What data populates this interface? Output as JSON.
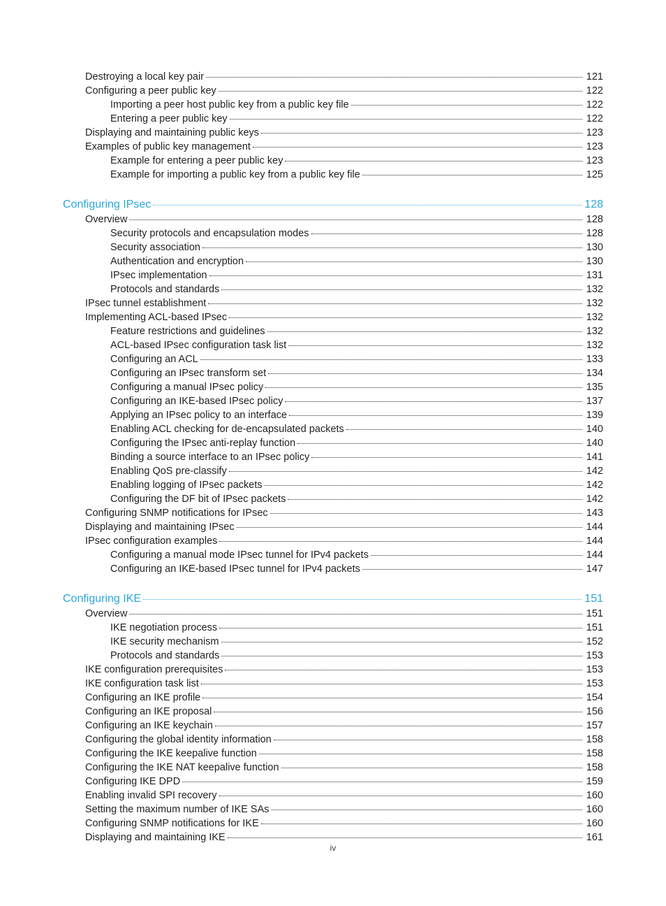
{
  "document": {
    "kind": "table-of-contents",
    "page_label": "iv",
    "accent_color": "#2ba6de",
    "text_color": "#231f20"
  },
  "entries": [
    {
      "level": 1,
      "type": "entry",
      "title": "Destroying a local key pair",
      "page": "121"
    },
    {
      "level": 1,
      "type": "entry",
      "title": "Configuring a peer public key",
      "page": "122"
    },
    {
      "level": 2,
      "type": "entry",
      "title": "Importing a peer host public key from a public key file",
      "page": "122"
    },
    {
      "level": 2,
      "type": "entry",
      "title": "Entering a peer public key",
      "page": "122"
    },
    {
      "level": 1,
      "type": "entry",
      "title": "Displaying and maintaining public keys",
      "page": "123"
    },
    {
      "level": 1,
      "type": "entry",
      "title": "Examples of public key management",
      "page": "123"
    },
    {
      "level": 2,
      "type": "entry",
      "title": "Example for entering a peer public key",
      "page": "123"
    },
    {
      "level": 2,
      "type": "entry",
      "title": "Example for importing a public key from a public key file",
      "page": "125"
    },
    {
      "level": 0,
      "type": "section",
      "title": "Configuring IPsec",
      "page": "128"
    },
    {
      "level": 1,
      "type": "entry",
      "title": "Overview",
      "page": "128"
    },
    {
      "level": 2,
      "type": "entry",
      "title": "Security protocols and encapsulation modes",
      "page": "128"
    },
    {
      "level": 2,
      "type": "entry",
      "title": "Security association",
      "page": "130"
    },
    {
      "level": 2,
      "type": "entry",
      "title": "Authentication and encryption",
      "page": "130"
    },
    {
      "level": 2,
      "type": "entry",
      "title": "IPsec implementation",
      "page": "131"
    },
    {
      "level": 2,
      "type": "entry",
      "title": "Protocols and standards",
      "page": "132"
    },
    {
      "level": 1,
      "type": "entry",
      "title": "IPsec tunnel establishment",
      "page": "132"
    },
    {
      "level": 1,
      "type": "entry",
      "title": "Implementing ACL-based IPsec",
      "page": "132"
    },
    {
      "level": 2,
      "type": "entry",
      "title": "Feature restrictions and guidelines",
      "page": "132"
    },
    {
      "level": 2,
      "type": "entry",
      "title": "ACL-based IPsec configuration task list",
      "page": "132"
    },
    {
      "level": 2,
      "type": "entry",
      "title": "Configuring an ACL",
      "page": "133"
    },
    {
      "level": 2,
      "type": "entry",
      "title": "Configuring an IPsec transform set",
      "page": "134"
    },
    {
      "level": 2,
      "type": "entry",
      "title": "Configuring a manual IPsec policy",
      "page": "135"
    },
    {
      "level": 2,
      "type": "entry",
      "title": "Configuring an IKE-based IPsec policy",
      "page": "137"
    },
    {
      "level": 2,
      "type": "entry",
      "title": "Applying an IPsec policy to an interface",
      "page": "139"
    },
    {
      "level": 2,
      "type": "entry",
      "title": "Enabling ACL checking for de-encapsulated packets",
      "page": "140"
    },
    {
      "level": 2,
      "type": "entry",
      "title": "Configuring the IPsec anti-replay function",
      "page": "140"
    },
    {
      "level": 2,
      "type": "entry",
      "title": "Binding a source interface to an IPsec policy",
      "page": "141"
    },
    {
      "level": 2,
      "type": "entry",
      "title": "Enabling QoS pre-classify",
      "page": "142"
    },
    {
      "level": 2,
      "type": "entry",
      "title": "Enabling logging of IPsec packets",
      "page": "142"
    },
    {
      "level": 2,
      "type": "entry",
      "title": "Configuring the DF bit of IPsec packets",
      "page": "142"
    },
    {
      "level": 1,
      "type": "entry",
      "title": "Configuring SNMP notifications for IPsec",
      "page": "143"
    },
    {
      "level": 1,
      "type": "entry",
      "title": "Displaying and maintaining IPsec",
      "page": "144"
    },
    {
      "level": 1,
      "type": "entry",
      "title": "IPsec configuration examples",
      "page": "144"
    },
    {
      "level": 2,
      "type": "entry",
      "title": "Configuring a manual mode IPsec tunnel for IPv4 packets",
      "page": "144"
    },
    {
      "level": 2,
      "type": "entry",
      "title": "Configuring an IKE-based IPsec tunnel for IPv4 packets",
      "page": "147"
    },
    {
      "level": 0,
      "type": "section",
      "title": "Configuring IKE",
      "page": "151"
    },
    {
      "level": 1,
      "type": "entry",
      "title": "Overview",
      "page": "151"
    },
    {
      "level": 2,
      "type": "entry",
      "title": "IKE negotiation process",
      "page": "151"
    },
    {
      "level": 2,
      "type": "entry",
      "title": "IKE security mechanism",
      "page": "152"
    },
    {
      "level": 2,
      "type": "entry",
      "title": "Protocols and standards",
      "page": "153"
    },
    {
      "level": 1,
      "type": "entry",
      "title": "IKE configuration prerequisites",
      "page": "153"
    },
    {
      "level": 1,
      "type": "entry",
      "title": "IKE configuration task list",
      "page": "153"
    },
    {
      "level": 1,
      "type": "entry",
      "title": "Configuring an IKE profile",
      "page": "154"
    },
    {
      "level": 1,
      "type": "entry",
      "title": "Configuring an IKE proposal",
      "page": "156"
    },
    {
      "level": 1,
      "type": "entry",
      "title": "Configuring an IKE keychain",
      "page": "157"
    },
    {
      "level": 1,
      "type": "entry",
      "title": "Configuring the global identity information",
      "page": "158"
    },
    {
      "level": 1,
      "type": "entry",
      "title": "Configuring the IKE keepalive function",
      "page": "158"
    },
    {
      "level": 1,
      "type": "entry",
      "title": "Configuring the IKE NAT keepalive function",
      "page": "158"
    },
    {
      "level": 1,
      "type": "entry",
      "title": "Configuring IKE DPD",
      "page": "159"
    },
    {
      "level": 1,
      "type": "entry",
      "title": "Enabling invalid SPI recovery",
      "page": "160"
    },
    {
      "level": 1,
      "type": "entry",
      "title": "Setting the maximum number of IKE SAs",
      "page": "160"
    },
    {
      "level": 1,
      "type": "entry",
      "title": "Configuring SNMP notifications for IKE",
      "page": "160"
    },
    {
      "level": 1,
      "type": "entry",
      "title": "Displaying and maintaining IKE",
      "page": "161"
    }
  ]
}
